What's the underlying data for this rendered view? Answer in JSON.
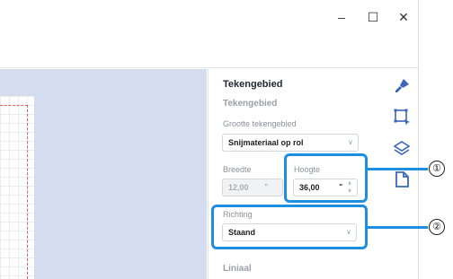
{
  "window": {
    "controls": {
      "minimize": "–",
      "maximize": "☐",
      "close": "✕"
    }
  },
  "panel": {
    "title": "Tekengebied",
    "section": "Tekengebied",
    "size_label": "Grootte tekengebied",
    "size_value": "Snijmateriaal op rol",
    "width_label": "Breedte",
    "width_value": "12,00",
    "width_unit": "\"",
    "height_label": "Hoogte",
    "height_value": "36,00",
    "height_unit": "\"",
    "orientation_label": "Richting",
    "orientation_value": "Staand",
    "ruler_section": "Liniaal"
  },
  "callouts": {
    "one": "①",
    "two": "②"
  },
  "sidebar_icons": [
    "brush-icon",
    "select-area-icon",
    "layers-icon",
    "page-icon"
  ],
  "colors": {
    "accent": "#1e8ee0",
    "canvas": "#d4dcef",
    "icon": "#3a66b8"
  }
}
